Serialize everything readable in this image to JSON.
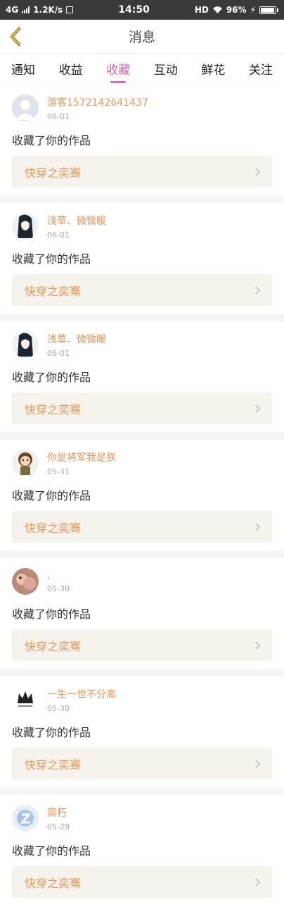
{
  "status_bar": {
    "network": "4G",
    "speed": "1.2K/s",
    "time": "14:50",
    "hd": "HD",
    "battery_percent": "96%",
    "battery_level": 0.96
  },
  "header": {
    "title": "消息",
    "back_icon": "chevron-left-icon"
  },
  "tabs": [
    {
      "label": "通知",
      "active": false
    },
    {
      "label": "收益",
      "active": false
    },
    {
      "label": "收藏",
      "active": true
    },
    {
      "label": "互动",
      "active": false
    },
    {
      "label": "鲜花",
      "active": false
    },
    {
      "label": "关注",
      "active": false
    }
  ],
  "messages": [
    {
      "username": "游客1572142641437",
      "date": "06-01",
      "action": "收藏了你的作品",
      "work": "快穿之奕骞",
      "avatar": "default-avatar"
    },
    {
      "username": "浅草、微微暖",
      "date": "06-01",
      "action": "收藏了你的作品",
      "work": "快穿之奕骞",
      "avatar": "anime-girl-avatar"
    },
    {
      "username": "浅草、微微暖",
      "date": "06-01",
      "action": "收藏了你的作品",
      "work": "快穿之奕骞",
      "avatar": "anime-girl-avatar"
    },
    {
      "username": "你是将军我是朕",
      "date": "05-31",
      "action": "收藏了你的作品",
      "work": "快穿之奕骞",
      "avatar": "cartoon-kid-avatar"
    },
    {
      "username": ",",
      "date": "05-30",
      "action": "收藏了你的作品",
      "work": "快穿之奕骞",
      "avatar": "photo-avatar"
    },
    {
      "username": "一生一世不分离",
      "date": "05-30",
      "action": "收藏了你的作品",
      "work": "快穿之奕骞",
      "avatar": "crown-avatar"
    },
    {
      "username": "腐朽",
      "date": "05-29",
      "action": "收藏了你的作品",
      "work": "快穿之奕骞",
      "avatar": "logo-avatar"
    }
  ],
  "colors": {
    "accent_pink": "#d86aa8",
    "username_orange": "#e8965a",
    "work_bg": "#f5f3ec"
  }
}
